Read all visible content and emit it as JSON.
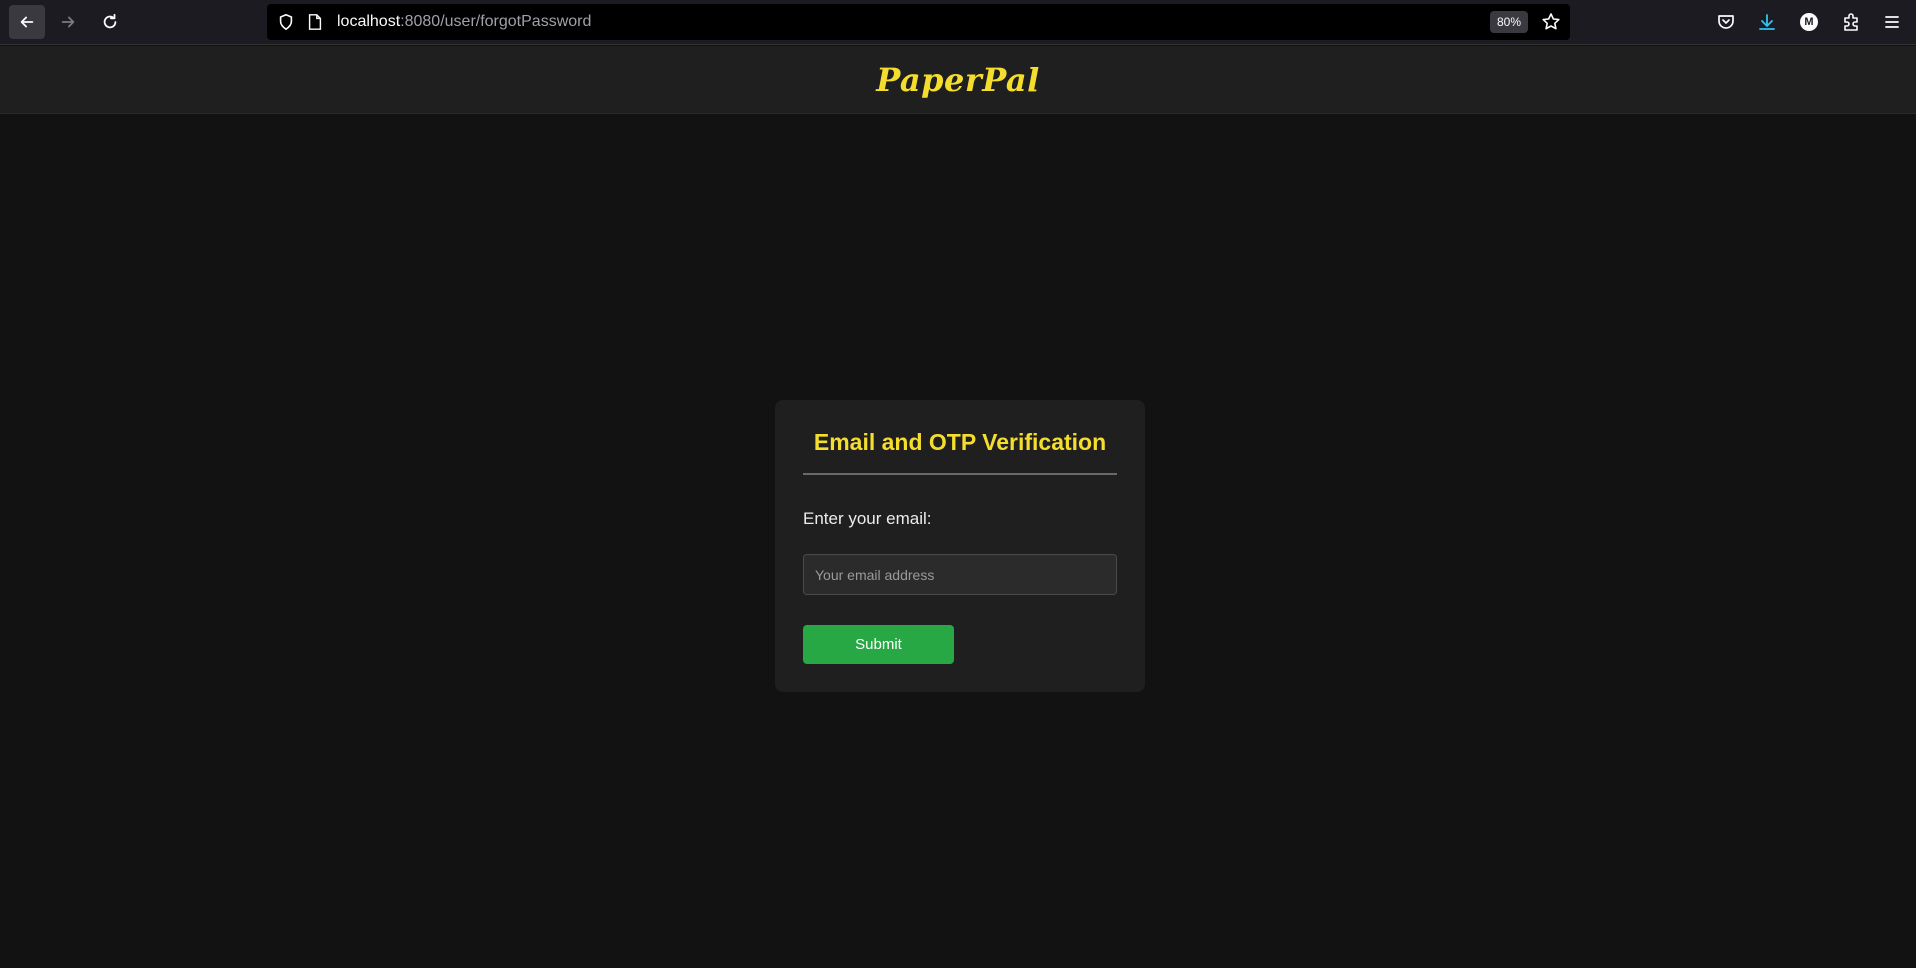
{
  "browser": {
    "url_host": "localhost",
    "url_path": ":8080/user/forgotPassword",
    "zoom": "80%",
    "account_initial": "M",
    "icons": {
      "back": "back-arrow-icon",
      "forward": "forward-arrow-icon",
      "reload": "reload-icon",
      "shield": "shield-icon",
      "page": "page-icon",
      "star": "star-icon",
      "pocket": "pocket-icon",
      "download": "download-icon",
      "extensions": "puzzle-icon",
      "menu": "hamburger-menu-icon"
    },
    "download_color": "#2ec4f5"
  },
  "header": {
    "brand": "PaperPal",
    "brand_color": "#f5dd2e"
  },
  "card": {
    "title": "Email and OTP Verification",
    "email_label": "Enter your email:",
    "email_placeholder": "Your email address",
    "email_value": "",
    "submit_label": "Submit",
    "submit_color": "#28a745"
  }
}
